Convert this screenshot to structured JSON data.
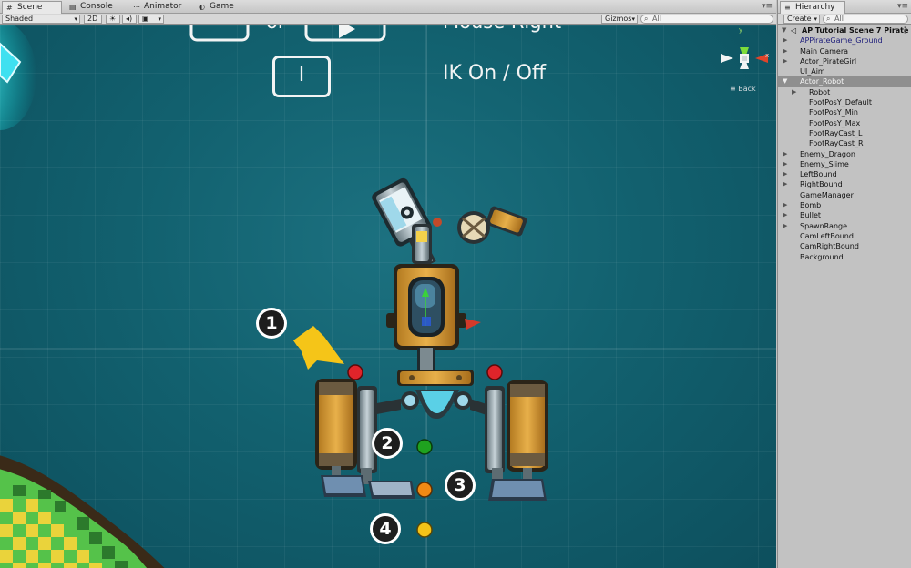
{
  "scene_panel": {
    "tabs": [
      {
        "label": "Scene",
        "icon": "scene-icon"
      },
      {
        "label": "Console",
        "icon": "console-icon"
      },
      {
        "label": "Animator",
        "icon": "animator-icon"
      },
      {
        "label": "Game",
        "icon": "game-icon"
      }
    ],
    "toolbar": {
      "shading_mode": "Shaded",
      "mode_2d": "2D",
      "gizmos_label": "Gizmos",
      "search_placeholder": "All"
    },
    "view": {
      "key_hint_caption": "IK On / Off",
      "key_hint_key": "I",
      "partial_caption_top": "Mouse Right",
      "partial_key_text": "or",
      "gizmo_back_label": "Back",
      "gizmo_axes": {
        "y": "y",
        "x": "x"
      }
    },
    "callouts": [
      "1",
      "2",
      "3",
      "4"
    ],
    "handle_colors": {
      "red": "#e0242a",
      "green": "#1fa21f",
      "orange": "#f08a14",
      "yellow": "#f4c318"
    },
    "arrow_color": "#f5c518"
  },
  "hierarchy_panel": {
    "tab_label": "Hierarchy",
    "create_label": "Create",
    "search_placeholder": "All",
    "scene_name": "AP Tutorial Scene 7 Pirate",
    "items": [
      {
        "label": "APPirateGame_Ground",
        "indent": 1,
        "expand": "closed",
        "style": "prefab"
      },
      {
        "label": "Main Camera",
        "indent": 1,
        "expand": "closed",
        "style": "normal"
      },
      {
        "label": "Actor_PirateGirl",
        "indent": 1,
        "expand": "closed",
        "style": "normal"
      },
      {
        "label": "UI_Aim",
        "indent": 1,
        "expand": "none",
        "style": "normal"
      },
      {
        "label": "Actor_Robot",
        "indent": 1,
        "expand": "open",
        "style": "selected"
      },
      {
        "label": "Robot",
        "indent": 2,
        "expand": "closed",
        "style": "normal"
      },
      {
        "label": "FootPosY_Default",
        "indent": 2,
        "expand": "none",
        "style": "normal"
      },
      {
        "label": "FootPosY_Min",
        "indent": 2,
        "expand": "none",
        "style": "normal"
      },
      {
        "label": "FootPosY_Max",
        "indent": 2,
        "expand": "none",
        "style": "normal"
      },
      {
        "label": "FootRayCast_L",
        "indent": 2,
        "expand": "none",
        "style": "normal"
      },
      {
        "label": "FootRayCast_R",
        "indent": 2,
        "expand": "none",
        "style": "normal"
      },
      {
        "label": "Enemy_Dragon",
        "indent": 1,
        "expand": "closed",
        "style": "normal"
      },
      {
        "label": "Enemy_Slime",
        "indent": 1,
        "expand": "closed",
        "style": "normal"
      },
      {
        "label": "LeftBound",
        "indent": 1,
        "expand": "closed",
        "style": "normal"
      },
      {
        "label": "RightBound",
        "indent": 1,
        "expand": "closed",
        "style": "normal"
      },
      {
        "label": "GameManager",
        "indent": 1,
        "expand": "none",
        "style": "normal"
      },
      {
        "label": "Bomb",
        "indent": 1,
        "expand": "closed",
        "style": "normal"
      },
      {
        "label": "Bullet",
        "indent": 1,
        "expand": "closed",
        "style": "normal"
      },
      {
        "label": "SpawnRange",
        "indent": 1,
        "expand": "closed",
        "style": "normal"
      },
      {
        "label": "CamLeftBound",
        "indent": 1,
        "expand": "none",
        "style": "normal"
      },
      {
        "label": "CamRightBound",
        "indent": 1,
        "expand": "none",
        "style": "normal"
      },
      {
        "label": "Background",
        "indent": 1,
        "expand": "none",
        "style": "normal"
      }
    ]
  }
}
